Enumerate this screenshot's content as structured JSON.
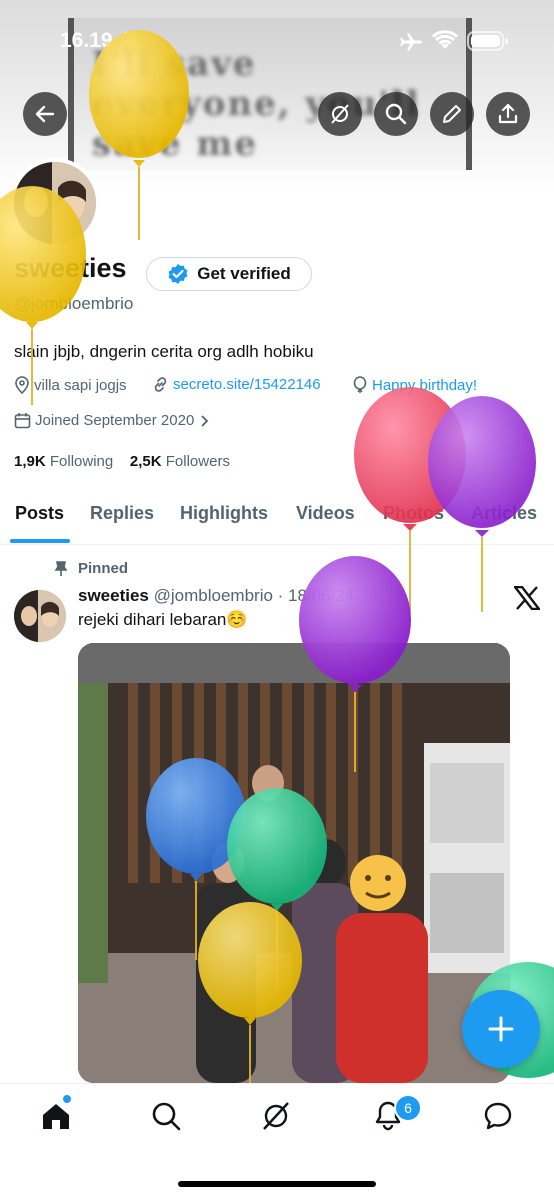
{
  "status_bar": {
    "time": "16.19"
  },
  "banner": {
    "text": "I'll save everyone, you'll save me"
  },
  "profile": {
    "display_name": "sweeties",
    "get_verified": "Get verified",
    "handle": "@jombloembrio",
    "bio": "slain jbjb, dngerin cerita org adlh hobiku",
    "location": "villa sapi jogjs",
    "website": "secreto.site/15422146",
    "birthday": "Happy birthday!",
    "joined": "Joined September 2020",
    "following_count": "1,9K",
    "following_label": "Following",
    "followers_count": "2,5K",
    "followers_label": "Followers"
  },
  "tabs": [
    {
      "label": "Posts"
    },
    {
      "label": "Replies"
    },
    {
      "label": "Highlights"
    },
    {
      "label": "Videos"
    },
    {
      "label": "Photos"
    },
    {
      "label": "Articles"
    }
  ],
  "post": {
    "pinned_label": "Pinned",
    "author_name": "sweeties",
    "author_handle": "@jombloembrio",
    "date": "· 18/06/24",
    "text": "rejeki dihari lebaran☺️"
  },
  "nav": {
    "icons": [
      "home-icon",
      "search-icon",
      "grok-icon",
      "notifications-icon",
      "messages-icon"
    ],
    "notification_count": "6"
  },
  "colors": {
    "accent": "#1d9bf0",
    "text_primary": "#0f1419",
    "text_secondary": "#536471",
    "balloon_yellow": "#f2c72b",
    "balloon_red": "#f04a6c",
    "balloon_purple": "#a23ad8",
    "balloon_blue": "#3a8be8",
    "balloon_green": "#2fd39a"
  }
}
